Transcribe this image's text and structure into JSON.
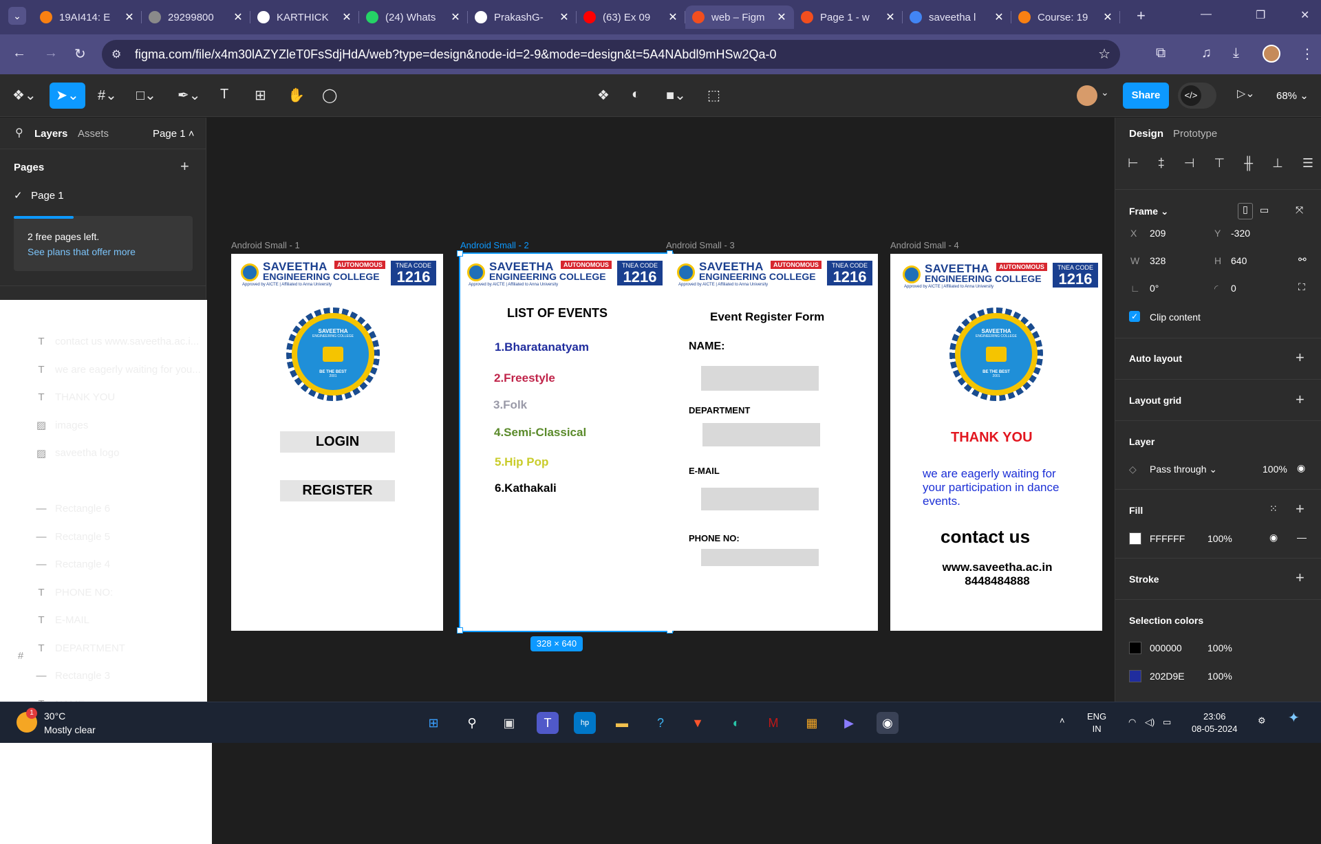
{
  "browser": {
    "tabs": [
      {
        "title": "19AI414: E",
        "icon": "moodle-icon",
        "color": "#f98012",
        "active": false
      },
      {
        "title": "29299800",
        "icon": "globe-icon",
        "color": "#8a8a8a",
        "active": false
      },
      {
        "title": "KARTHICK",
        "icon": "github-icon",
        "color": "#ffffff",
        "active": false
      },
      {
        "title": "(24) Whats",
        "icon": "whatsapp-icon",
        "color": "#25d366",
        "active": false
      },
      {
        "title": "PrakashG-",
        "icon": "github-icon",
        "color": "#ffffff",
        "active": false
      },
      {
        "title": "(63) Ex 09",
        "icon": "youtube-icon",
        "color": "#ff0000",
        "active": false
      },
      {
        "title": "web – Figm",
        "icon": "figma-icon",
        "color": "#f24e1e",
        "active": true
      },
      {
        "title": "Page 1 - w",
        "icon": "figma-icon",
        "color": "#f24e1e",
        "active": false
      },
      {
        "title": "saveetha l",
        "icon": "google-icon",
        "color": "#4285f4",
        "active": false
      },
      {
        "title": "Course: 19",
        "icon": "moodle-icon",
        "color": "#f98012",
        "active": false
      }
    ],
    "url": "figma.com/file/x4m30lAZYZleT0FsSdjHdA/web?type=design&node-id=2-9&mode=design&t=5A4NAbdl9mHSw2Qa-0"
  },
  "toolbar": {
    "share_label": "Share",
    "zoom": "68%"
  },
  "left_panel": {
    "tab_layers": "Layers",
    "tab_assets": "Assets",
    "page_selector": "Page 1",
    "pages_heading": "Pages",
    "pages": [
      "Page 1"
    ],
    "free_pages_text": "2 free pages left.",
    "free_pages_link": "See plans that offer more",
    "layers": [
      {
        "name": "Android Small - 4",
        "type": "frame"
      },
      {
        "name": "contact us www.saveetha.ac.i...",
        "type": "text"
      },
      {
        "name": "we are eagerly waiting for you...",
        "type": "text"
      },
      {
        "name": "THANK YOU",
        "type": "text"
      },
      {
        "name": "images",
        "type": "image"
      },
      {
        "name": "saveetha logo",
        "type": "image"
      },
      {
        "name": "Android Small - 3",
        "type": "frame"
      },
      {
        "name": "Rectangle 6",
        "type": "rect"
      },
      {
        "name": "Rectangle 5",
        "type": "rect"
      },
      {
        "name": "Rectangle 4",
        "type": "rect"
      },
      {
        "name": "PHONE NO:",
        "type": "text"
      },
      {
        "name": "E-MAIL",
        "type": "text"
      },
      {
        "name": "DEPARTMENT",
        "type": "text"
      },
      {
        "name": "Rectangle 3",
        "type": "rect"
      },
      {
        "name": "NAME:",
        "type": "text"
      }
    ]
  },
  "canvas": {
    "college": {
      "line1": "SAVEETHA",
      "line2": "ENGINEERING COLLEGE",
      "autonomous": "AUTONOMOUS",
      "tnea_label": "TNEA CODE",
      "tnea_code": "1216",
      "approved": "Approved by AICTE | Affiliated to Anna University",
      "logo_text": "SAVEETHA",
      "logo_sub": "ENGINEERING COLLEGE",
      "logo_motto": "BE THE BEST",
      "logo_year": "2001"
    },
    "frames": [
      {
        "label": "Android Small - 1",
        "login": "LOGIN",
        "register": "REGISTER"
      },
      {
        "label": "Android Small - 2",
        "title": "LIST OF EVENTS",
        "events": [
          {
            "text": "1.Bharatanatyam",
            "color": "#202d9e"
          },
          {
            "text": "2.Freestyle",
            "color": "#c0244a"
          },
          {
            "text": "3.Folk",
            "color": "#9a9aa8"
          },
          {
            "text": "4.Semi-Classical",
            "color": "#5a8a2a"
          },
          {
            "text": "5.Hip Pop",
            "color": "#c9cc2a"
          },
          {
            "text": "6.Kathakali",
            "color": "#000000"
          }
        ]
      },
      {
        "label": "Android Small - 3",
        "title": "Event Register Form",
        "name_label": "NAME:",
        "dept_label": "DEPARTMENT",
        "email_label": "E-MAIL",
        "phone_label": "PHONE NO:"
      },
      {
        "label": "Android Small - 4",
        "thank_you": "THANK YOU",
        "waiting": "we are eagerly waiting for your participation in dance events.",
        "contact": "contact us",
        "website": "www.saveetha.ac.in",
        "phone": "8448484888"
      }
    ],
    "size_tag": "328 × 640"
  },
  "right_panel": {
    "tab_design": "Design",
    "tab_prototype": "Prototype",
    "frame_heading": "Frame",
    "x": "209",
    "y": "-320",
    "w": "328",
    "h": "640",
    "rotation": "0°",
    "radius": "0",
    "clip_content": "Clip content",
    "auto_layout": "Auto layout",
    "layout_grid": "Layout grid",
    "layer_heading": "Layer",
    "blend": "Pass through",
    "opacity": "100%",
    "fill_heading": "Fill",
    "fill_hex": "FFFFFF",
    "fill_opacity": "100%",
    "stroke_heading": "Stroke",
    "selection_colors_heading": "Selection colors",
    "selection_colors": [
      {
        "hex": "000000",
        "opacity": "100%",
        "color": "#000000"
      },
      {
        "hex": "202D9E",
        "opacity": "100%",
        "color": "#202d9e"
      }
    ]
  },
  "taskbar": {
    "weather_badge": "1",
    "temperature": "30°C",
    "weather_desc": "Mostly clear",
    "lang1": "ENG",
    "lang2": "IN",
    "time": "23:06",
    "date": "08-05-2024"
  }
}
